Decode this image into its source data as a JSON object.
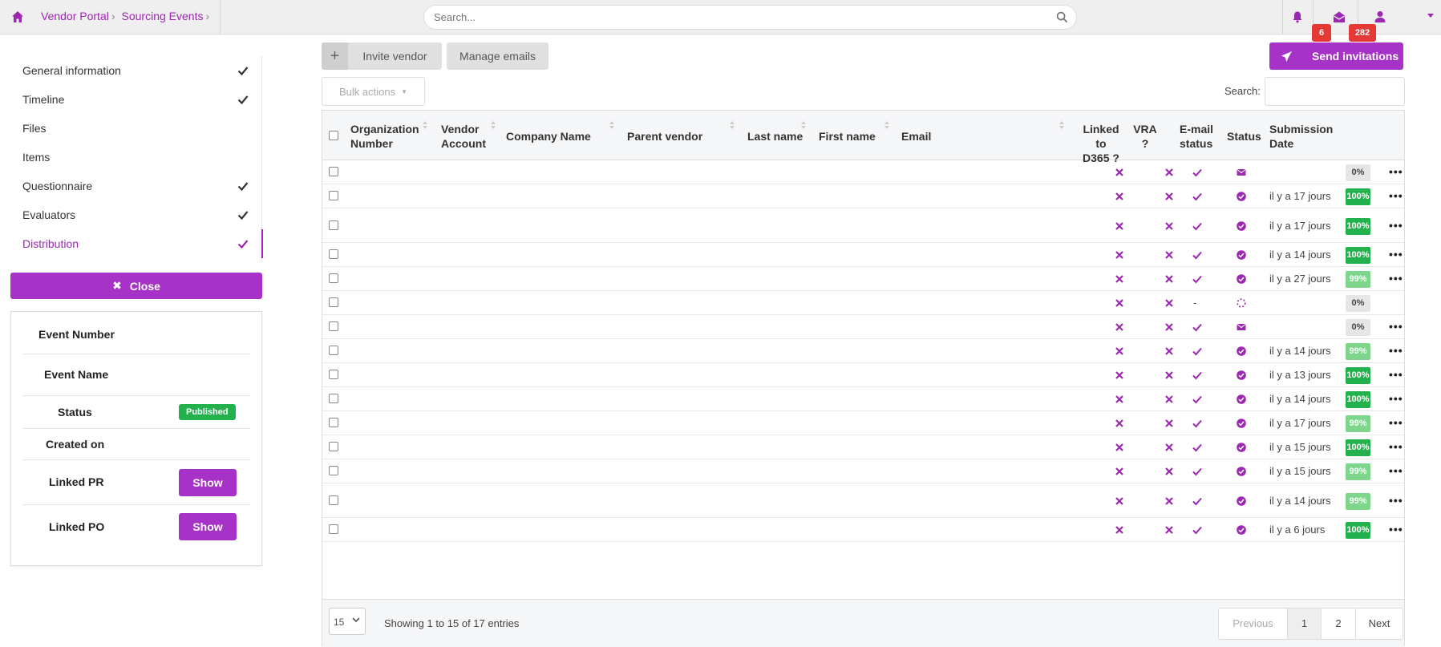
{
  "topbar": {
    "breadcrumb": [
      "Vendor Portal",
      "Sourcing Events"
    ],
    "search_placeholder": "Search...",
    "notification_count": "6",
    "message_count": "282"
  },
  "sidebar": {
    "items": [
      {
        "label": "General information",
        "checked": true
      },
      {
        "label": "Timeline",
        "checked": true
      },
      {
        "label": "Files",
        "checked": false
      },
      {
        "label": "Items",
        "checked": false
      },
      {
        "label": "Questionnaire",
        "checked": true
      },
      {
        "label": "Evaluators",
        "checked": true
      },
      {
        "label": "Distribution",
        "checked": true,
        "active": true
      }
    ],
    "close_label": "Close"
  },
  "info": {
    "event_number_label": "Event Number",
    "event_name_label": "Event Name",
    "status_label": "Status",
    "status_value": "Published",
    "created_on_label": "Created on",
    "linked_pr_label": "Linked PR",
    "linked_po_label": "Linked PO",
    "show_label": "Show"
  },
  "toolbar": {
    "invite_label": "Invite vendor",
    "manage_emails_label": "Manage emails",
    "send_label": "Send invitations",
    "bulk_label": "Bulk actions",
    "search_label": "Search:"
  },
  "table": {
    "headers": {
      "org_number_1": "Organization",
      "org_number_2": "Number",
      "vendor_account_1": "Vendor",
      "vendor_account_2": "Account",
      "company": "Company Name",
      "parent": "Parent vendor",
      "last": "Last name",
      "first": "First name",
      "email": "Email",
      "linked_1": "Linked to",
      "linked_2": "D365 ?",
      "vra_1": "VRA",
      "vra_2": "?",
      "email_status_1": "E-mail",
      "email_status_2": "status",
      "status": "Status",
      "submission_1": "Submission",
      "submission_2": "Date"
    },
    "rows": [
      {
        "email_status": "check",
        "status": "envelope",
        "date": "",
        "pct": "0%",
        "pct_style": "grey",
        "menu": true
      },
      {
        "email_status": "check",
        "status": "circle-check",
        "date": "il y a 17 jours",
        "pct": "100%",
        "pct_style": "green",
        "menu": true
      },
      {
        "email_status": "check",
        "status": "circle-check",
        "date": "il y a 17 jours",
        "pct": "100%",
        "pct_style": "green",
        "menu": true
      },
      {
        "email_status": "check",
        "status": "circle-check",
        "date": "il y a 14 jours",
        "pct": "100%",
        "pct_style": "green",
        "menu": true
      },
      {
        "email_status": "check",
        "status": "circle-check",
        "date": "il y a 27 jours",
        "pct": "99%",
        "pct_style": "lgreen",
        "menu": true
      },
      {
        "email_status": "dash",
        "status": "spinner",
        "date": "",
        "pct": "0%",
        "pct_style": "grey",
        "menu": false
      },
      {
        "email_status": "check",
        "status": "envelope",
        "date": "",
        "pct": "0%",
        "pct_style": "grey",
        "menu": true
      },
      {
        "email_status": "check",
        "status": "circle-check",
        "date": "il y a 14 jours",
        "pct": "99%",
        "pct_style": "lgreen",
        "menu": true
      },
      {
        "email_status": "check",
        "status": "circle-check",
        "date": "il y a 13 jours",
        "pct": "100%",
        "pct_style": "green",
        "menu": true
      },
      {
        "email_status": "check",
        "status": "circle-check",
        "date": "il y a 14 jours",
        "pct": "100%",
        "pct_style": "green",
        "menu": true
      },
      {
        "email_status": "check",
        "status": "circle-check",
        "date": "il y a 17 jours",
        "pct": "99%",
        "pct_style": "lgreen",
        "menu": true
      },
      {
        "email_status": "check",
        "status": "circle-check",
        "date": "il y a 15 jours",
        "pct": "100%",
        "pct_style": "green",
        "menu": true
      },
      {
        "email_status": "check",
        "status": "circle-check",
        "date": "il y a 15 jours",
        "pct": "99%",
        "pct_style": "lgreen",
        "menu": true
      },
      {
        "email_status": "check",
        "status": "circle-check",
        "date": "il y a 14 jours",
        "pct": "99%",
        "pct_style": "lgreen",
        "menu": true
      },
      {
        "email_status": "check",
        "status": "circle-check",
        "date": "il y a 6 jours",
        "pct": "100%",
        "pct_style": "green",
        "menu": true
      }
    ],
    "dash_text": "-",
    "menu_text": "•••"
  },
  "footer": {
    "page_size": "15",
    "showing": "Showing 1 to 15 of 17 entries",
    "prev": "Previous",
    "page1": "1",
    "page2": "2",
    "next": "Next"
  },
  "colors": {
    "accent": "#9c27b0",
    "success": "#22b14c",
    "danger": "#e53935"
  }
}
